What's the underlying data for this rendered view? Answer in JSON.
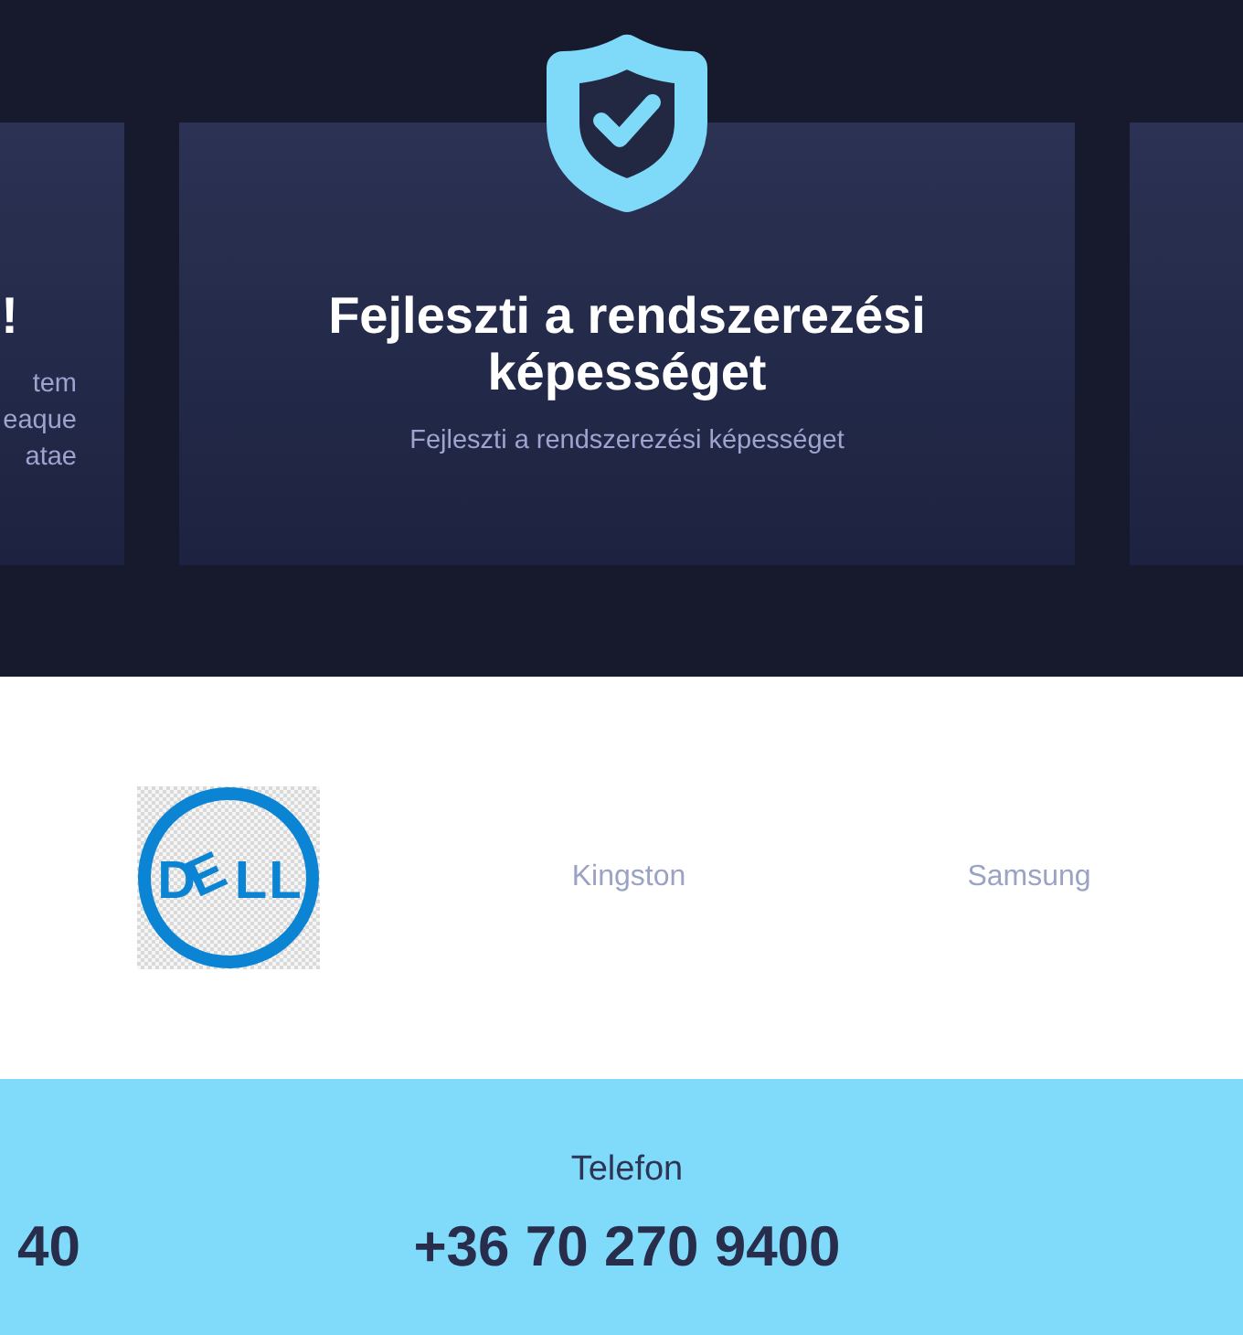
{
  "carousel": {
    "cards": [
      {
        "kind": "clipped",
        "title": "!",
        "description_lines": [
          "tem",
          "eaque",
          "atae"
        ]
      },
      {
        "kind": "featured",
        "title": "Fejleszti a rendszerezési képességet",
        "description": "Fejleszti a rendszerezési képességet"
      },
      {
        "kind": "empty"
      }
    ]
  },
  "brands": [
    {
      "kind": "logo",
      "text": "DELL"
    },
    {
      "kind": "name",
      "text": "Kingston"
    },
    {
      "kind": "name",
      "text": "Samsung"
    }
  ],
  "contacts": [
    {
      "value": "40"
    },
    {
      "label": "Telefon",
      "value": "+36 70 270 9400"
    }
  ]
}
